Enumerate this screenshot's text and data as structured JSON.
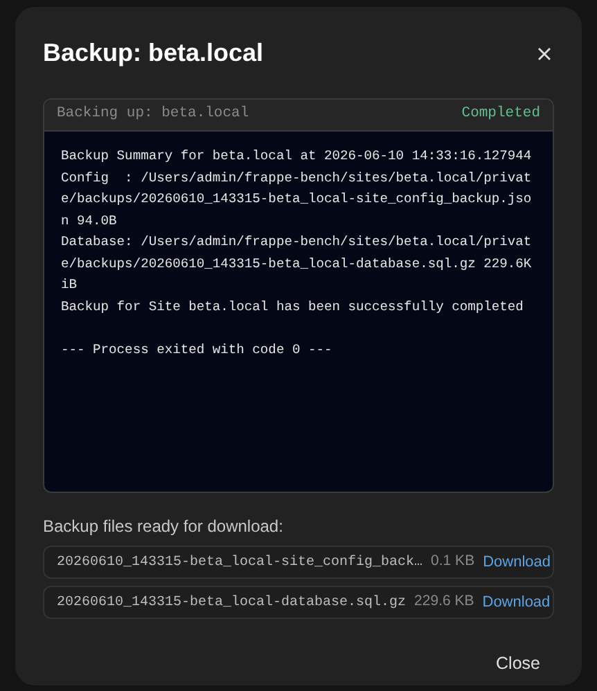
{
  "dialog": {
    "title": "Backup: beta.local",
    "terminal": {
      "status_text": "Backing up: beta.local",
      "status": "Completed",
      "lines": [
        {
          "kind": "output",
          "text": "Backup Summary for beta.local at 2026-06-10 14:33:16.127944"
        },
        {
          "kind": "output",
          "text": "Config  : /Users/admin/frappe-bench/sites/beta.local/privat"
        },
        {
          "kind": "output",
          "text": "e/backups/20260610_143315-beta_local-site_config_backup.jso"
        },
        {
          "kind": "output",
          "text": "n 94.0B"
        },
        {
          "kind": "output",
          "text": "Database: /Users/admin/frappe-bench/sites/beta.local/privat"
        },
        {
          "kind": "output",
          "text": "e/backups/20260610_143315-beta_local-database.sql.gz 229.6K"
        },
        {
          "kind": "output",
          "text": "iB"
        },
        {
          "kind": "output",
          "text": "Backup for Site beta.local has been successfully completed"
        },
        {
          "kind": "exit",
          "text": "--- Process exited with code 0 ---"
        }
      ]
    },
    "files_label": "Backup files ready for download:",
    "files": [
      {
        "name": "20260610_143315-beta_local-site_config_back…",
        "size": "0.1 KB",
        "action": "Download"
      },
      {
        "name": "20260610_143315-beta_local-database.sql.gz",
        "size": "229.6 KB",
        "action": "Download"
      }
    ],
    "close_button": "Close"
  }
}
